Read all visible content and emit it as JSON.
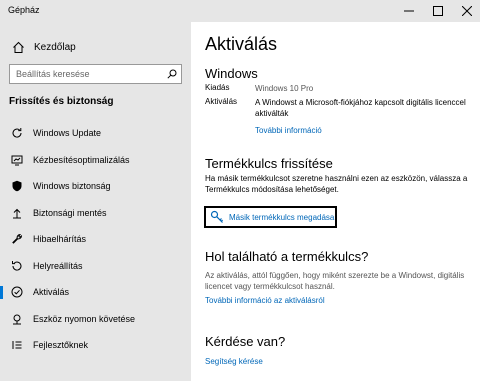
{
  "window": {
    "title": "Gépház"
  },
  "sidebar": {
    "home_label": "Kezdőlap",
    "search_placeholder": "Beállítás keresése",
    "section_title": "Frissítés és biztonság",
    "items": [
      {
        "label": "Windows Update",
        "icon": "sync-icon"
      },
      {
        "label": "Kézbesítésoptimalizálás",
        "icon": "delivery-optimization-icon"
      },
      {
        "label": "Windows biztonság",
        "icon": "shield-icon"
      },
      {
        "label": "Biztonsági mentés",
        "icon": "backup-icon"
      },
      {
        "label": "Hibaelhárítás",
        "icon": "wrench-icon"
      },
      {
        "label": "Helyreállítás",
        "icon": "recovery-icon"
      },
      {
        "label": "Aktiválás",
        "icon": "activation-check-icon",
        "active": true
      },
      {
        "label": "Eszköz nyomon követése",
        "icon": "find-device-icon"
      },
      {
        "label": "Fejlesztőknek",
        "icon": "developer-icon"
      }
    ]
  },
  "main": {
    "title": "Aktiválás",
    "windows_section": {
      "heading": "Windows",
      "edition_key": "Kiadás",
      "edition_value": "Windows 10 Pro",
      "activation_key": "Aktiválás",
      "activation_value": "A Windowst a Microsoft-fiókjához kapcsolt digitális licenccel aktiválták",
      "more_info_link": "További információ"
    },
    "product_key_section": {
      "heading": "Termékkulcs frissítése",
      "description": "Ha másik termékkulcsot szeretne használni ezen az eszközön, válassza a Termékkulcs módosítása lehetőséget.",
      "button_label": "Másik termékkulcs megadása"
    },
    "where_key_section": {
      "heading": "Hol található a termékkulcs?",
      "description": "Az aktiválás, attól függően, hogy miként szerezte be a Windowst, digitális licencet vagy termékkulcsot használ.",
      "link": "További információ az aktiválásról"
    },
    "question_section": {
      "heading": "Kérdése van?",
      "link": "Segítség kérése"
    }
  },
  "colors": {
    "accent": "#0078d7",
    "link": "#0067b8",
    "sidebar_bg": "#e6e6e6"
  }
}
